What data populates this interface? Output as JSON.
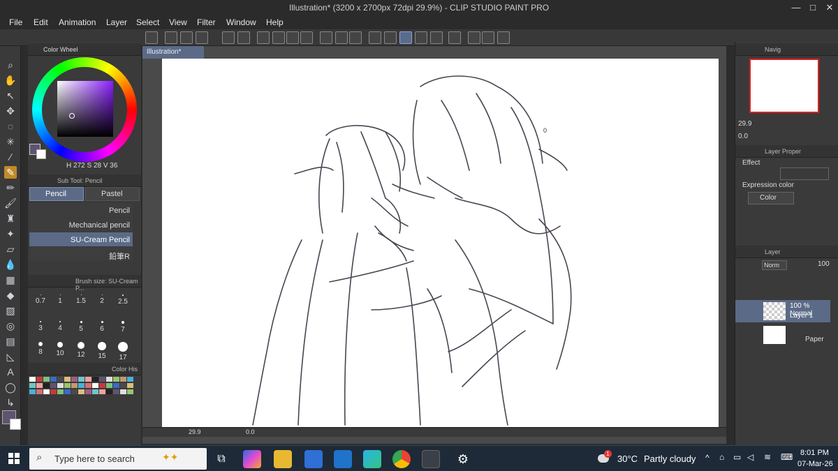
{
  "window": {
    "title": "Illustration* (3200 x 2700px 72dpi 29.9%)  - CLIP STUDIO PAINT PRO",
    "controls": [
      "—",
      "□",
      "✕"
    ]
  },
  "menu": [
    "File",
    "Edit",
    "Animation",
    "Layer",
    "Select",
    "View",
    "Filter",
    "Window",
    "Help"
  ],
  "color_wheel": {
    "tab_label": "Color Wheel",
    "h": "272",
    "s": "28",
    "v": "36",
    "main_color": "#5e5470",
    "sub_color": "#ffffff"
  },
  "subtool": {
    "header": "Sub Tool: Pencil",
    "tabs": [
      "Pencil",
      "Pastel"
    ],
    "brushes": [
      "Pencil",
      "Mechanical pencil",
      "SU-Cream Pencil",
      "鉛筆R"
    ],
    "selected_index": 2
  },
  "brush_size": {
    "header": "Brush size: SU-Cream P...",
    "sizes": [
      "0.7",
      "1",
      "1.5",
      "2",
      "2.5",
      "3",
      "4",
      "5",
      "6",
      "7",
      "8",
      "10",
      "12",
      "15",
      "17"
    ]
  },
  "color_history": {
    "tab_label": "Color His"
  },
  "document": {
    "tab": "Illustration*",
    "zoom": "29.9",
    "rotation": "0.0",
    "annotation": "0"
  },
  "navigator": {
    "tab": "Navig",
    "zoom": "29.9",
    "rotation": "0.0"
  },
  "layer_property": {
    "tab": "Layer Proper",
    "effect_label": "Effect",
    "expression_label": "Expression color",
    "expression_value": "Color"
  },
  "layer_panel": {
    "tab": "Layer",
    "blend_mode": "Norm",
    "opacity": "100",
    "layers": [
      {
        "mode": "100 % Normal",
        "name": "Layer 1"
      },
      {
        "mode": "",
        "name": "Paper"
      }
    ]
  },
  "taskbar": {
    "search_placeholder": "Type here to search",
    "weather_temp": "30°C",
    "weather_text": "Partly cloudy",
    "weather_badge": "1",
    "time": "8:01 PM",
    "date": "07-Mar-26"
  }
}
